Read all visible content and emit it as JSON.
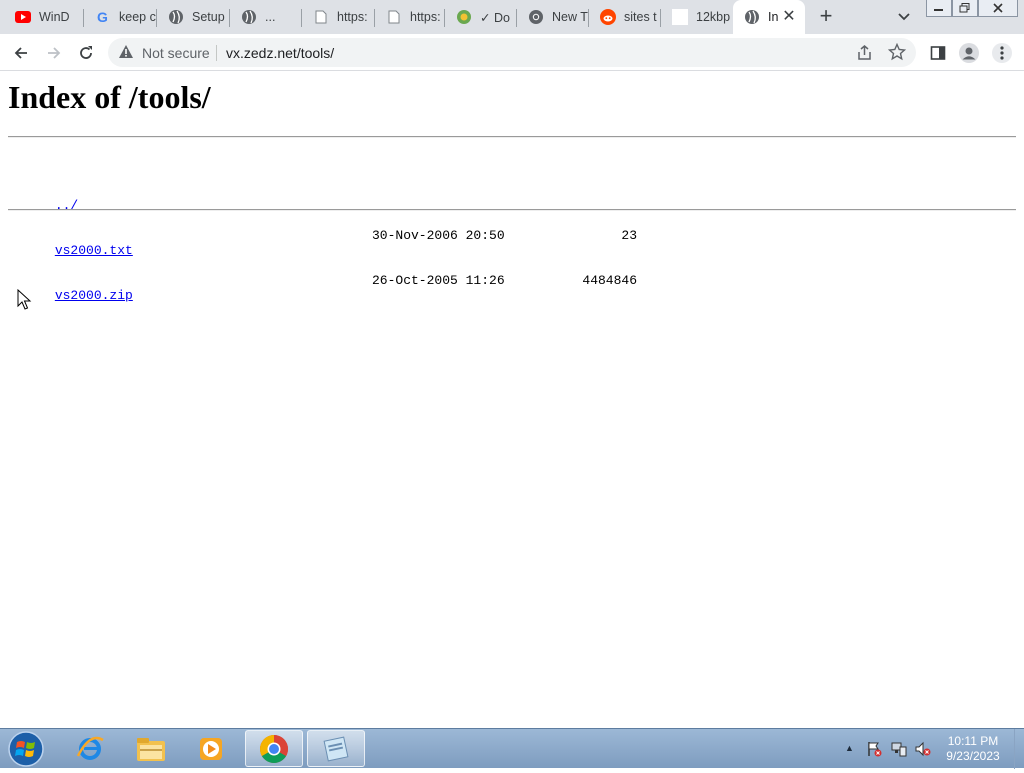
{
  "browser": {
    "tabs": [
      {
        "label": "WinD",
        "icon": "youtube-icon"
      },
      {
        "label": "keep c",
        "icon": "google-icon"
      },
      {
        "label": "Setup",
        "icon": "globe-icon"
      },
      {
        "label": "...",
        "icon": "globe-icon"
      },
      {
        "label": "https:",
        "icon": "page-icon"
      },
      {
        "label": "https:",
        "icon": "page-icon"
      },
      {
        "label": "✓ Do",
        "icon": "extension-icon"
      },
      {
        "label": "New T",
        "icon": "chrome-icon"
      },
      {
        "label": "sites t",
        "icon": "reddit-icon"
      },
      {
        "label": "12kbp",
        "icon": "blank-icon"
      },
      {
        "label": "In",
        "icon": "globe-icon",
        "active": true
      }
    ],
    "new_tab_glyph": "+",
    "close_glyph": "✕",
    "security_label": "Not secure",
    "url": "vx.zedz.net/tools/"
  },
  "page": {
    "title": "Index of /tools/",
    "entries": [
      {
        "name": "../",
        "date": "",
        "size": ""
      },
      {
        "name": "vs2000.txt",
        "date": "30-Nov-2006 20:50",
        "size": "23"
      },
      {
        "name": "vs2000.zip",
        "date": "26-Oct-2005 11:26",
        "size": "4484846"
      }
    ]
  },
  "taskbar": {
    "apps": [
      "internet-explorer-icon",
      "file-explorer-icon",
      "media-player-icon",
      "chrome-icon",
      "notepad-icon"
    ],
    "time": "10:11 PM",
    "date": "9/23/2023"
  },
  "colors": {
    "link": "#0000ee",
    "tabstrip": "#dee1e6",
    "omnibox": "#f1f3f4"
  }
}
